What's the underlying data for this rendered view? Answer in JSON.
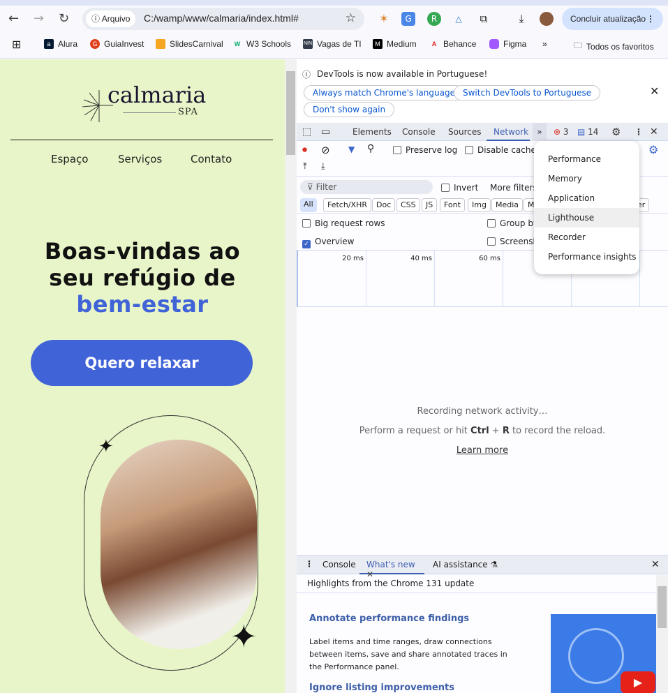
{
  "browser": {
    "chip_label": "Arquivo",
    "url": "C:/wamp/www/calmaria/index.html#",
    "update_button": "Concluir atualização",
    "bookmarks": [
      {
        "label": "Alura",
        "color": "#051933"
      },
      {
        "label": "GuiaInvest",
        "color": "#e2401c"
      },
      {
        "label": "SlidesCarnival",
        "color": "#f5a623"
      },
      {
        "label": "W3 Schools",
        "color": "#04aa6d"
      },
      {
        "label": "Vagas de TI",
        "color": "#333b4c"
      },
      {
        "label": "Medium",
        "color": "#000000"
      },
      {
        "label": "Behance",
        "color": "#e81c1c"
      },
      {
        "label": "Figma",
        "color": "#a259ff"
      }
    ],
    "more_bookmarks": "»",
    "all_bookmarks": "Todos os favoritos"
  },
  "page": {
    "logo_text": "calmaria",
    "logo_sub": "SPA",
    "nav": [
      "Espaço",
      "Serviços",
      "Contato"
    ],
    "hero_line1": "Boas-vindas ao",
    "hero_line2": "seu refúgio de",
    "hero_accent": "bem-estar",
    "cta": "Quero relaxar",
    "accent_color": "#4163d8",
    "bg_color": "#e8f5c8"
  },
  "devtools": {
    "infobar": {
      "message": "DevTools is now available in Portuguese!",
      "buttons": [
        "Always match Chrome's language",
        "Switch DevTools to Portuguese",
        "Don't show again"
      ]
    },
    "tabs": [
      "Elements",
      "Console",
      "Sources",
      "Network"
    ],
    "active_tab": "Network",
    "errors": "3",
    "messages": "14",
    "toolbar": {
      "preserve_log": "Preserve log",
      "disable_cache": "Disable cache"
    },
    "filter_placeholder": "Filter",
    "invert": "Invert",
    "more_filters": "More filters",
    "type_filters": [
      "All",
      "Fetch/XHR",
      "Doc",
      "CSS",
      "JS",
      "Font",
      "Img",
      "Media",
      "M"
    ],
    "type_filter_tail": "er",
    "options": {
      "big_rows": "Big request rows",
      "group_by": "Group by",
      "overview": "Overview",
      "screenshots": "Screensh"
    },
    "ticks": [
      "20 ms",
      "40 ms",
      "60 ms"
    ],
    "empty": {
      "line1": "Recording network activity…",
      "line2_pre": "Perform a request or hit ",
      "key1": "Ctrl",
      "plus": " + ",
      "key2": "R",
      "line2_post": " to record the reload.",
      "learn_more": "Learn more"
    },
    "menu": [
      "Performance",
      "Memory",
      "Application",
      "Lighthouse",
      "Recorder",
      "Performance insights"
    ],
    "menu_highlight": "Lighthouse",
    "drawer": {
      "tabs": [
        "Console",
        "What's new",
        "AI assistance"
      ],
      "active": "What's new",
      "highlights": "Highlights from the Chrome 131 update",
      "h1": "Annotate performance findings",
      "p1": "Label items and time ranges, draw connections between items, save and share annotated traces in the Performance panel.",
      "h2": "Ignore listing improvements"
    }
  }
}
